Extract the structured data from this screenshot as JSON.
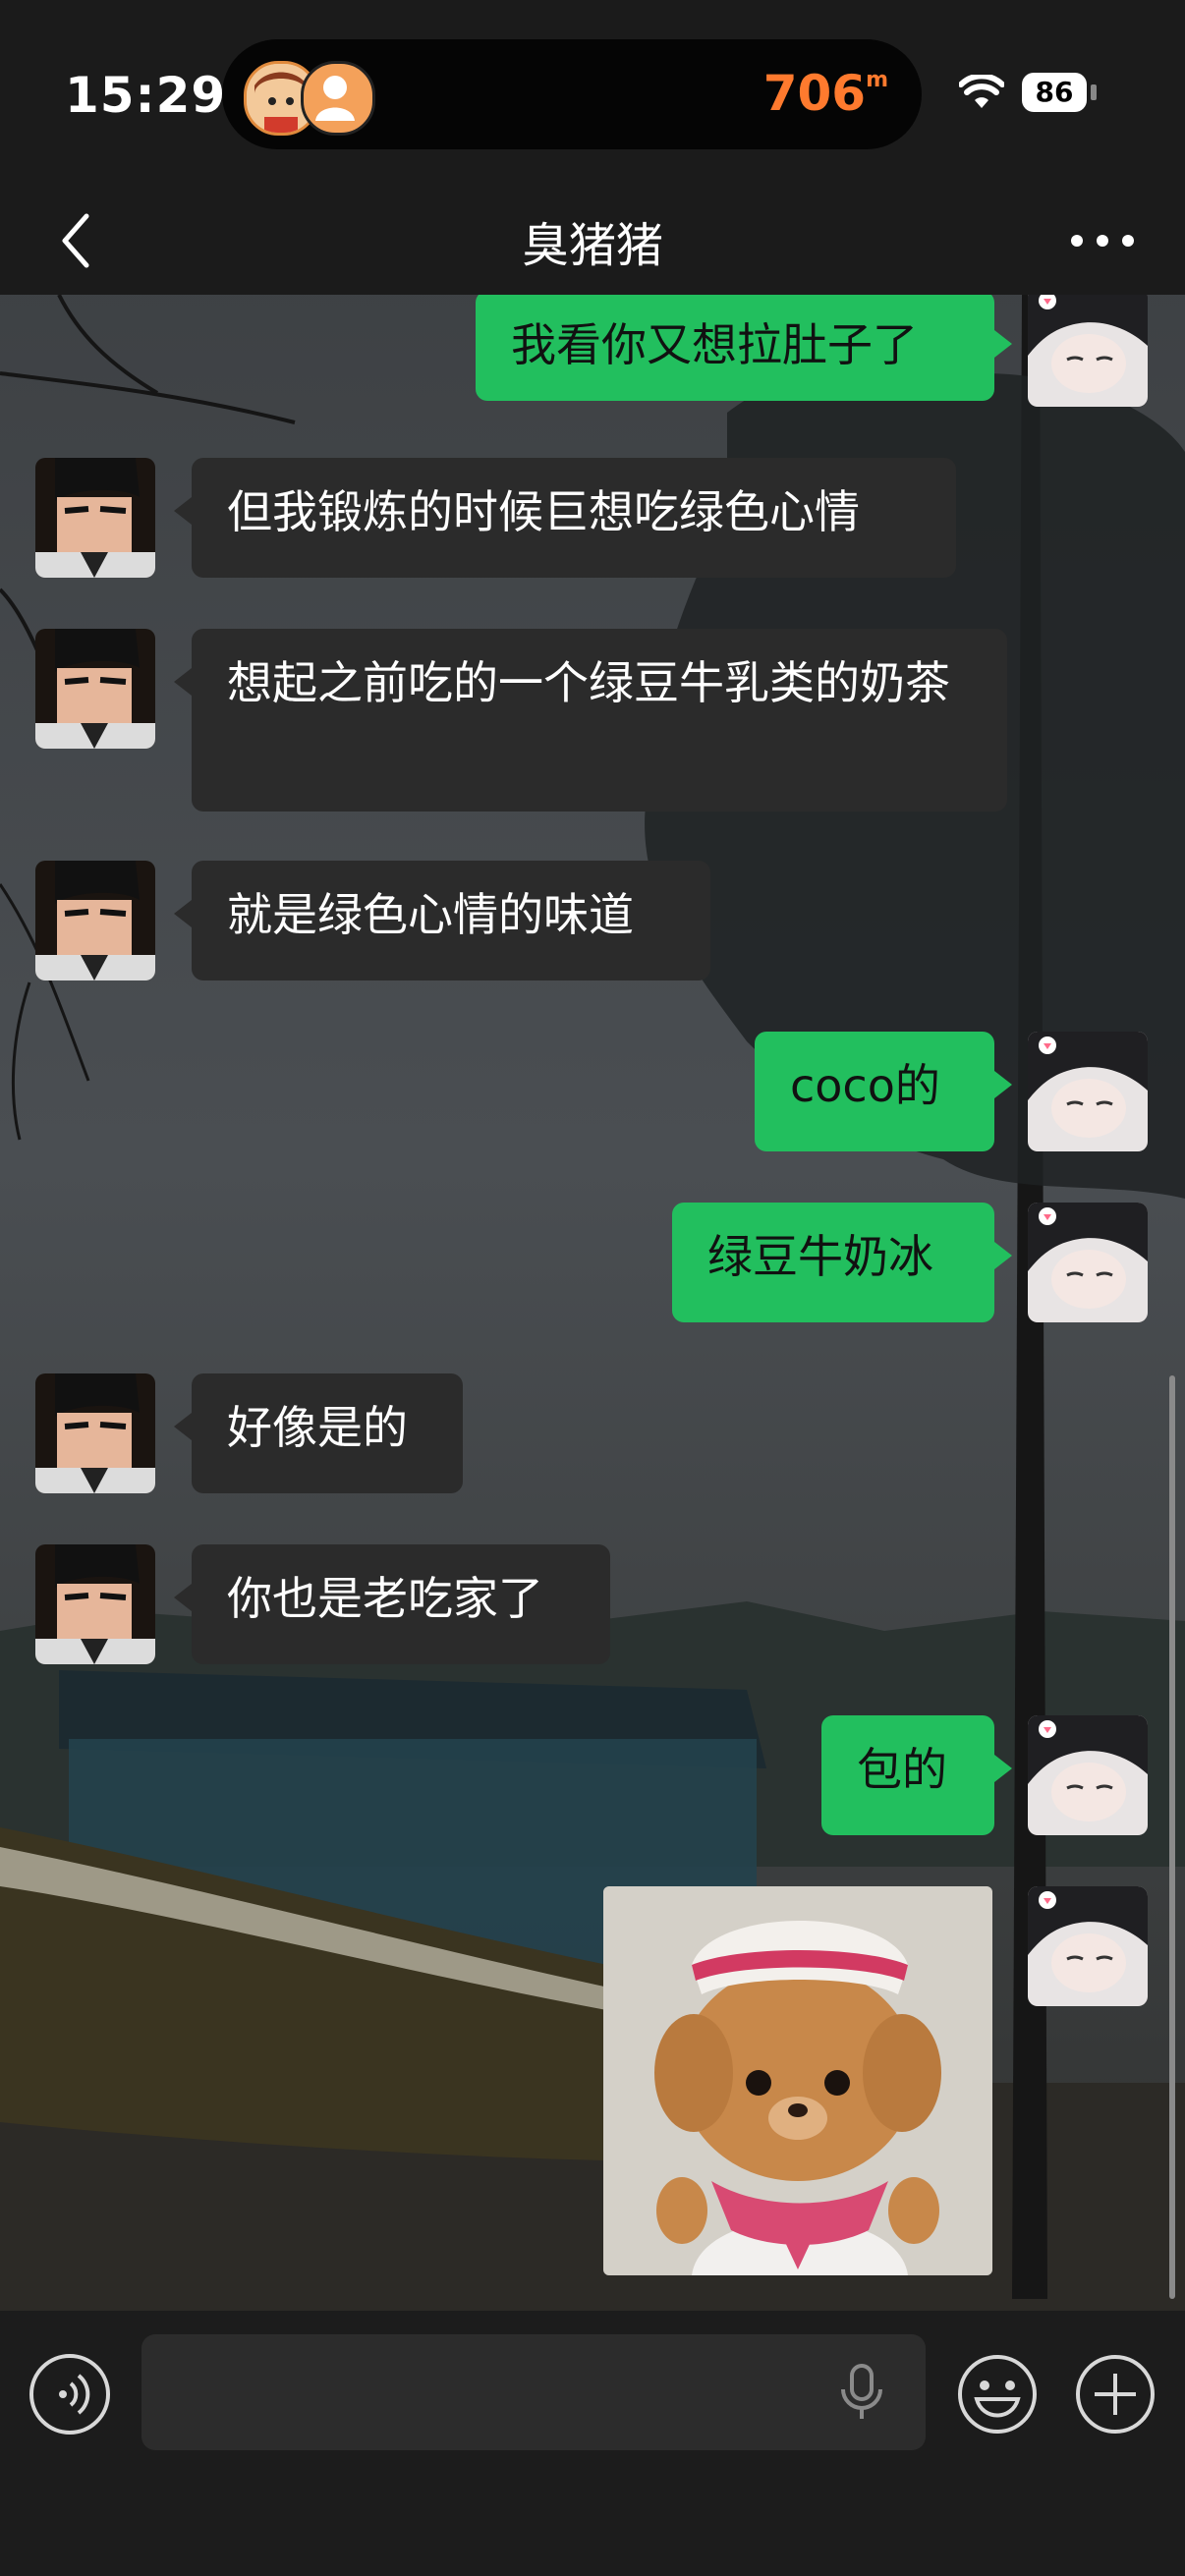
{
  "status_bar": {
    "time": "15:29",
    "distance_value": "706",
    "distance_unit": "m",
    "battery": "86",
    "wifi_icon": "wifi-icon"
  },
  "navbar": {
    "title": "臭猪猪",
    "back_icon": "chevron-left-icon",
    "more_icon": "more-dots-icon"
  },
  "messages": [
    {
      "side": "out",
      "text": "我看你又想拉肚子了"
    },
    {
      "side": "in",
      "text": "但我锻炼的时候巨想吃绿色心情"
    },
    {
      "side": "in",
      "text": "想起之前吃的一个绿豆牛乳类的奶茶"
    },
    {
      "side": "in",
      "text": "就是绿色心情的味道"
    },
    {
      "side": "out",
      "text": "coco的"
    },
    {
      "side": "out",
      "text": "绿豆牛奶冰"
    },
    {
      "side": "in",
      "text": "好像是的"
    },
    {
      "side": "in",
      "text": "你也是老吃家了"
    },
    {
      "side": "out",
      "text": "包的"
    },
    {
      "side": "out",
      "type": "sticker",
      "sticker_icon": "bear-doll-sticker"
    }
  ],
  "input_bar": {
    "placeholder": "",
    "voice_icon": "voice-mode-icon",
    "mic_icon": "microphone-icon",
    "emoji_icon": "emoji-icon",
    "plus_icon": "plus-circle-icon"
  },
  "colors": {
    "outgoing_bubble": "#22bf5e",
    "incoming_bubble": "#2b2b2b",
    "distance_accent": "#ff7a2e"
  }
}
